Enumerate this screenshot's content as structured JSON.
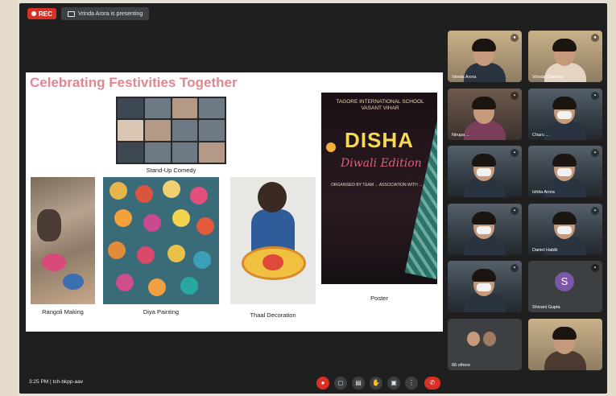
{
  "top": {
    "rec_label": "REC",
    "presenting_text": "Vrinda Arora is presenting"
  },
  "slide": {
    "title": "Celebrating Festivities Together",
    "captions": {
      "standup": "Stand-Up Comedy",
      "rangoli": "Rangoli Making",
      "diya": "Diya Painting",
      "thaal": "Thaal Decoration",
      "poster": "Poster"
    },
    "poster": {
      "school": "TAGORE INTERNATIONAL SCHOOL VASANT VIHAR",
      "headline": "DISHA",
      "subhead": "Diwali Edition",
      "body": "ORGANISED BY TEAM ... ASSOCIATION WITH ..."
    }
  },
  "participants": [
    {
      "name": "Vrinda Arora",
      "mic": "●"
    },
    {
      "name": "Vrinda Chandra",
      "mic": "●"
    },
    {
      "name": "Nirupa ...",
      "mic": "▪"
    },
    {
      "name": "Charu ...",
      "mic": "▪"
    },
    {
      "name": "",
      "mic": "▪"
    },
    {
      "name": "Ishita Arora",
      "mic": "▪"
    },
    {
      "name": "",
      "mic": "▪"
    },
    {
      "name": "Daniel Habib",
      "mic": "▪"
    },
    {
      "name": "",
      "mic": "▪"
    },
    {
      "name": "Shivani Gupta",
      "mic": "▪",
      "avatar": "S"
    },
    {
      "name": "66 others",
      "mic": ""
    },
    {
      "name": "",
      "mic": ""
    }
  ],
  "bottom": {
    "clock": "3:25 PM  |  tch-bkpp-aav",
    "controls": [
      "●",
      "◻",
      "▤",
      "✋",
      "▣",
      "⋮",
      "✆"
    ]
  },
  "colors": {
    "meet_bg": "#1f1f1f",
    "rec_red": "#d93025",
    "title_pink": "#e2868f",
    "avatar_purple": "#7c57a8"
  }
}
